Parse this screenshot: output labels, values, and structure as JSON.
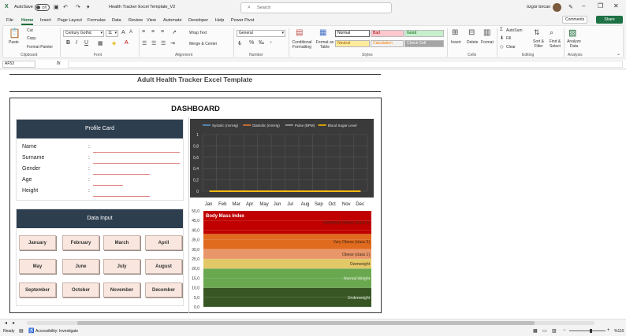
{
  "titlebar": {
    "autosave_label": "AutoSave",
    "autosave_state": "Off",
    "filename": "Health Tracker Excel Template_V2",
    "search_placeholder": "Search",
    "user_name": "özgür bircan"
  },
  "menu": {
    "tabs": [
      "File",
      "Home",
      "Insert",
      "Page Layout",
      "Formulas",
      "Data",
      "Review",
      "View",
      "Automate",
      "Developer",
      "Help",
      "Power Pivot"
    ],
    "active": "Home",
    "comments_label": "Comments",
    "share_label": "Share"
  },
  "ribbon": {
    "clipboard": {
      "paste": "Paste",
      "cut": "Cut",
      "copy": "Copy",
      "format_painter": "Format Painter",
      "group": "Clipboard"
    },
    "font": {
      "name": "Century Gothic",
      "size": "11",
      "group": "Font"
    },
    "alignment": {
      "wrap": "Wrap Text",
      "merge": "Merge & Center",
      "group": "Alignment"
    },
    "number": {
      "format": "General",
      "group": "Number"
    },
    "styles": {
      "conditional": "Conditional Formatting",
      "format_table": "Format as Table",
      "cells": [
        {
          "label": "Normal",
          "bg": "#ffffff",
          "fg": "#000000"
        },
        {
          "label": "Bad",
          "bg": "#ffc7ce",
          "fg": "#9c0006"
        },
        {
          "label": "Good",
          "bg": "#c6efce",
          "fg": "#006100"
        },
        {
          "label": "Neutral",
          "bg": "#ffeb9c",
          "fg": "#9c5700"
        },
        {
          "label": "Calculation",
          "bg": "#f2f2f2",
          "fg": "#fa7d00"
        },
        {
          "label": "Check Cell",
          "bg": "#a5a5a5",
          "fg": "#ffffff"
        }
      ],
      "group": "Styles"
    },
    "cells": {
      "insert": "Insert",
      "delete": "Delete",
      "format": "Format",
      "group": "Cells"
    },
    "editing": {
      "autosum": "AutoSum",
      "fill": "Fill",
      "clear": "Clear",
      "sort": "Sort & Filter",
      "find": "Find & Select",
      "group": "Editing"
    },
    "analysis": {
      "analyze": "Analyze Data",
      "group": "Analysis"
    }
  },
  "formula_bar": {
    "name_box": "AF53",
    "fx": "fx",
    "value": ""
  },
  "sheet": {
    "title": "Adult Health Tracker Excel Template",
    "dashboard_title": "DASHBOARD",
    "profile": {
      "header": "Profile Card",
      "fields": [
        "Name",
        "Surname",
        "Gender",
        "Age",
        "Height"
      ]
    },
    "data_input": {
      "header": "Data Input",
      "months": [
        "January",
        "February",
        "March",
        "April",
        "May",
        "June",
        "July",
        "August",
        "September",
        "October",
        "November",
        "December"
      ]
    }
  },
  "chart_data": [
    {
      "type": "line",
      "legend_position": "top",
      "categories": [
        "Jan",
        "Feb",
        "Mar",
        "Apr",
        "May",
        "Jun",
        "Jul",
        "Aug",
        "Sep",
        "Oct",
        "Nov",
        "Dec"
      ],
      "series": [
        {
          "name": "Systolic (mmHg)",
          "color": "#5b9bd5",
          "values": [
            0,
            0,
            0,
            0,
            0,
            0,
            0,
            0,
            0,
            0,
            0,
            0
          ]
        },
        {
          "name": "Diastolic (mmHg)",
          "color": "#ed7d31",
          "values": [
            0,
            0,
            0,
            0,
            0,
            0,
            0,
            0,
            0,
            0,
            0,
            0
          ]
        },
        {
          "name": "Pulse (BPM)",
          "color": "#a5a5a5",
          "values": [
            0,
            0,
            0,
            0,
            0,
            0,
            0,
            0,
            0,
            0,
            0,
            0
          ]
        },
        {
          "name": "Blood Sugar Level",
          "color": "#ffc000",
          "values": [
            0,
            0,
            0,
            0,
            0,
            0,
            0,
            0,
            0,
            0,
            0,
            0
          ]
        }
      ],
      "yticks": [
        "0",
        "0,2",
        "0,4",
        "0,6",
        "0,8",
        "1"
      ],
      "ylim": [
        0,
        1
      ],
      "grid": true
    },
    {
      "type": "area",
      "title": "Body Mass Index",
      "yticks": [
        "0,0",
        "5,0",
        "10,0",
        "15,0",
        "20,0",
        "25,0",
        "30,0",
        "35,0",
        "40,0",
        "45,0",
        "50,0"
      ],
      "ylim": [
        0,
        50
      ],
      "bands": [
        {
          "label": "Underweight",
          "from": 0,
          "to": 10,
          "color": "#375623"
        },
        {
          "label": "Normal Weight",
          "from": 10,
          "to": 20,
          "color": "#6aa84f"
        },
        {
          "label": "Overweight",
          "from": 20,
          "to": 25,
          "color": "#e2c866"
        },
        {
          "label": "Obese (class 1)",
          "from": 25,
          "to": 30,
          "color": "#e8966a"
        },
        {
          "label": "Very Obese (class 2)",
          "from": 30,
          "to": 38,
          "color": "#e06a1e"
        },
        {
          "label": "Extremely Obese (class 3)",
          "from": 38,
          "to": 50,
          "color": "#c00000"
        }
      ]
    }
  ],
  "sheettabs": {
    "scroll_prev": "◂",
    "scroll_next": "▸"
  },
  "status": {
    "ready": "Ready",
    "accessibility": "Accessibility: Investigate",
    "zoom": "%110"
  }
}
